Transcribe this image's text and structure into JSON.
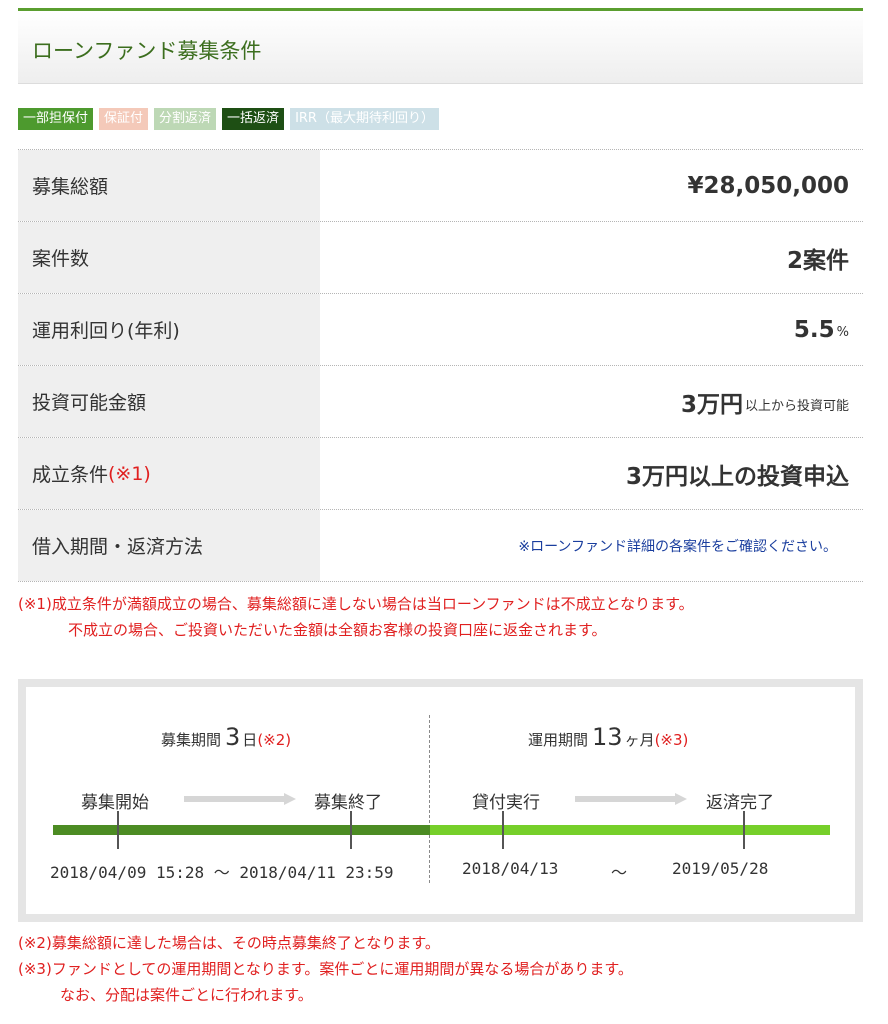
{
  "header": {
    "title": "ローンファンド募集条件"
  },
  "tags": [
    {
      "label": "一部担保付"
    },
    {
      "label": "保証付"
    },
    {
      "label": "分割返済"
    },
    {
      "label": "一括返済"
    },
    {
      "label": "IRR（最大期待利回り）"
    }
  ],
  "rows": {
    "total": {
      "label": "募集総額",
      "value": "¥28,050,000"
    },
    "count": {
      "label": "案件数",
      "value": "2案件"
    },
    "yield": {
      "label": "運用利回り(年利)",
      "value": "5.5",
      "unit": "%"
    },
    "min": {
      "label": "投資可能金額",
      "value": "3万円",
      "suffix": "以上から投資可能"
    },
    "condition": {
      "label": "成立条件",
      "ref": "(※1)",
      "value": "3万円以上の投資申込"
    },
    "period": {
      "label": "借入期間・返済方法",
      "note": "※ローンファンド詳細の各案件をご確認ください。"
    }
  },
  "note1": {
    "line1": "(※1)成立条件が満額成立の場合、募集総額に達しない場合は当ローンファンドは不成立となります。",
    "line2": "不成立の場合、ご投資いただいた金額は全額お客様の投資口座に返金されます。"
  },
  "timeline": {
    "recruit": {
      "label": "募集期間",
      "number": "3",
      "unit": "日",
      "ref": "(※2)"
    },
    "operation": {
      "label": "運用期間",
      "number": "13",
      "unit": "ヶ月",
      "ref": "(※3)"
    },
    "milestones": {
      "start": "募集開始",
      "end": "募集終了",
      "loan": "貸付実行",
      "repay": "返済完了"
    },
    "dates": {
      "recruit_range": "2018/04/09 15:28 〜 2018/04/11 23:59",
      "loan_date": "2018/04/13",
      "tilde": "〜",
      "repay_date": "2019/05/28"
    },
    "colors": {
      "recruit_bar": "#4c8c23",
      "operation_bar": "#76cf2a"
    }
  },
  "notes2": {
    "n2": "(※2)募集総額に達した場合は、その時点募集終了となります。",
    "n3": "(※3)ファンドとしての運用期間となります。案件ごとに運用期間が異なる場合があります。",
    "n3b": "なお、分配は案件ごとに行われます。"
  }
}
